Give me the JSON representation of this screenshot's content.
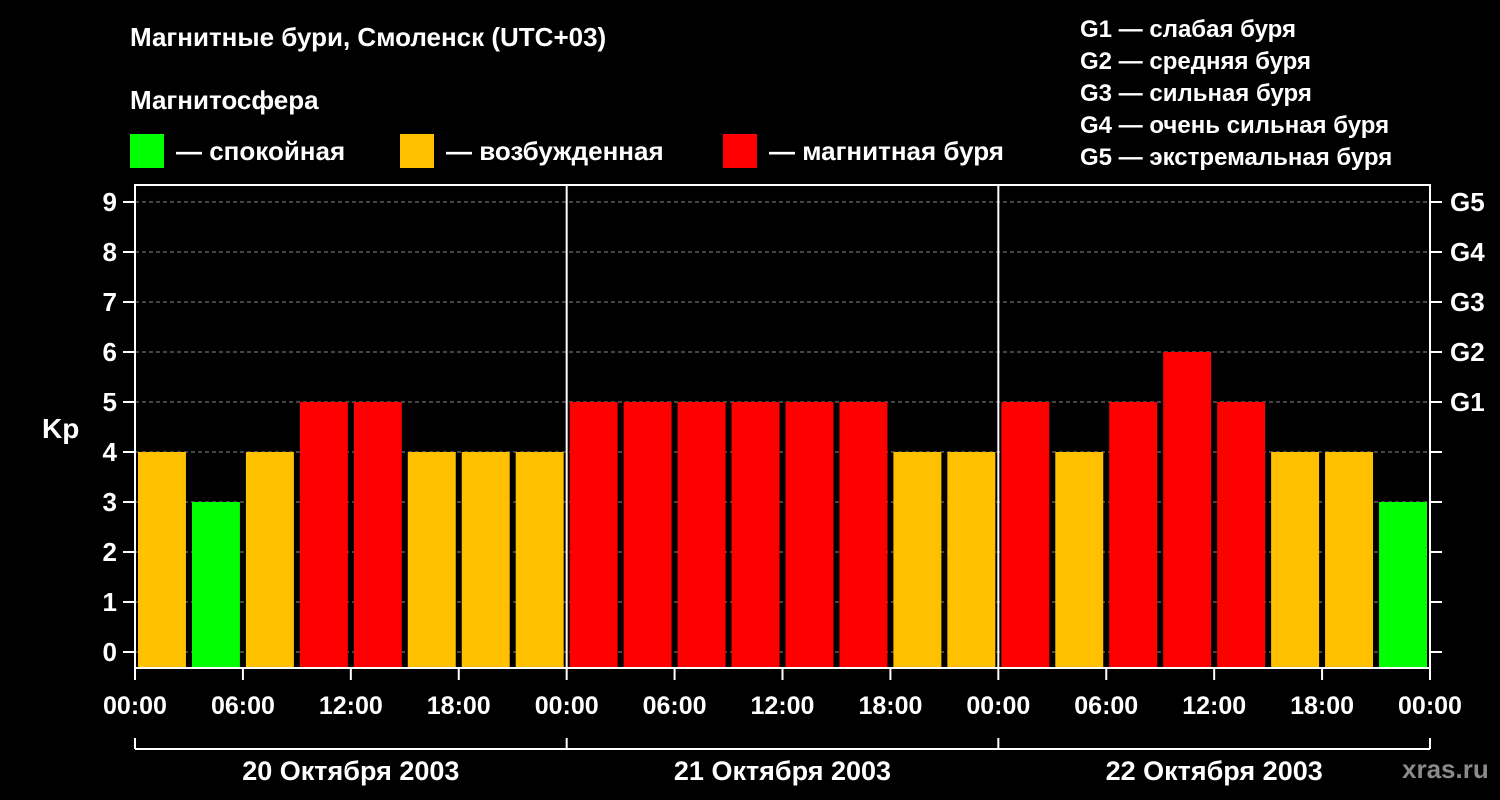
{
  "header": {
    "title": "Магнитные бури, Смоленск (UTC+03)",
    "subtitle": "Магнитосфера"
  },
  "legend": [
    {
      "label": "— спокойная",
      "color": "#00ff00"
    },
    {
      "label": "— возбужденная",
      "color": "#ffc000"
    },
    {
      "label": "— магнитная буря",
      "color": "#ff0000"
    }
  ],
  "storm_scale": [
    "G1 — слабая буря",
    "G2 — средняя буря",
    "G3 — сильная буря",
    "G4 — очень сильная буря",
    "G5 — экстремальная буря"
  ],
  "watermark": "xras.ru",
  "colors": {
    "quiet": "#00ff00",
    "active": "#ffc000",
    "storm": "#ff0000",
    "background": "#000000",
    "grid": "#888888"
  },
  "chart_data": {
    "type": "bar",
    "ylabel": "Kp",
    "ylim": [
      0,
      9
    ],
    "yticks": [
      "0",
      "1",
      "2",
      "3",
      "4",
      "5",
      "6",
      "7",
      "8",
      "9"
    ],
    "right_axis_labels": [
      {
        "kp": 5,
        "label": "G1"
      },
      {
        "kp": 6,
        "label": "G2"
      },
      {
        "kp": 7,
        "label": "G3"
      },
      {
        "kp": 8,
        "label": "G4"
      },
      {
        "kp": 9,
        "label": "G5"
      }
    ],
    "time_ticks": [
      "00:00",
      "06:00",
      "12:00",
      "18:00",
      "00:00",
      "06:00",
      "12:00",
      "18:00",
      "00:00",
      "06:00",
      "12:00",
      "18:00",
      "00:00"
    ],
    "days": [
      "20 Октября 2003",
      "21 Октября 2003",
      "22 Октября 2003"
    ],
    "grid": true,
    "values": [
      4,
      3,
      4,
      5,
      5,
      4,
      4,
      4,
      5,
      5,
      5,
      5,
      5,
      5,
      4,
      4,
      5,
      4,
      5,
      6,
      5,
      4,
      4,
      3
    ],
    "levels": [
      "active",
      "quiet",
      "active",
      "storm",
      "storm",
      "active",
      "active",
      "active",
      "storm",
      "storm",
      "storm",
      "storm",
      "storm",
      "storm",
      "active",
      "active",
      "storm",
      "active",
      "storm",
      "storm",
      "storm",
      "active",
      "active",
      "quiet"
    ]
  }
}
